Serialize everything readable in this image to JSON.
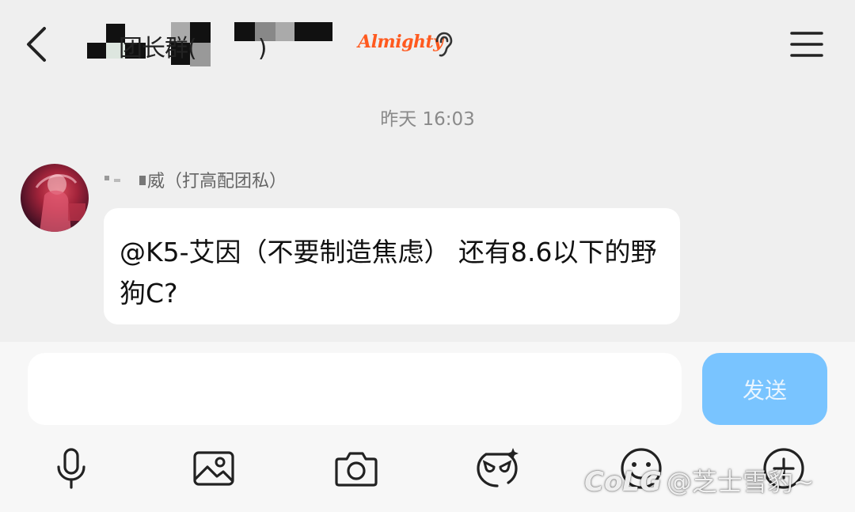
{
  "header": {
    "title_visible_fragment": "团长群(",
    "title_trailing": ")",
    "brand_badge": "Almighty",
    "icons": {
      "back": "chevron-left-icon",
      "ear": "ear-icon",
      "menu": "hamburger-menu-icon"
    }
  },
  "chat": {
    "timestamp": "昨天 16:03",
    "messages": [
      {
        "sender": "威（打高配团私）",
        "text": "@K5-艾因（不要制造焦虑） 还有8.6以下的野狗C?"
      }
    ]
  },
  "composer": {
    "input_value": "",
    "input_placeholder": "",
    "send_label": "发送"
  },
  "toolbar": {
    "items": [
      {
        "icon": "microphone-icon"
      },
      {
        "icon": "image-icon"
      },
      {
        "icon": "camera-icon"
      },
      {
        "icon": "sticker-icon"
      },
      {
        "icon": "emoji-icon"
      },
      {
        "icon": "add-icon"
      }
    ]
  },
  "watermark": {
    "logo": "CoLG",
    "text": "@芝士雪豹~"
  },
  "colors": {
    "background": "#efefef",
    "bubble": "#ffffff",
    "send_button": "#79c4ff",
    "brand": "#ff5a1f"
  }
}
